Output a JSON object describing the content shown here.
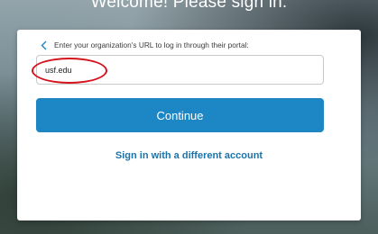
{
  "page": {
    "headline": "Welcome! Please sign in."
  },
  "form": {
    "back_icon": "chevron-left-icon",
    "prompt": "Enter your organization's URL to log in through their portal:",
    "url_value": "usf.edu",
    "continue_label": "Continue",
    "alt_signin_label": "Sign in with a different account"
  },
  "annotation": {
    "color": "#d4121c"
  },
  "colors": {
    "accent": "#1d87c5",
    "link": "#1b73a8"
  }
}
